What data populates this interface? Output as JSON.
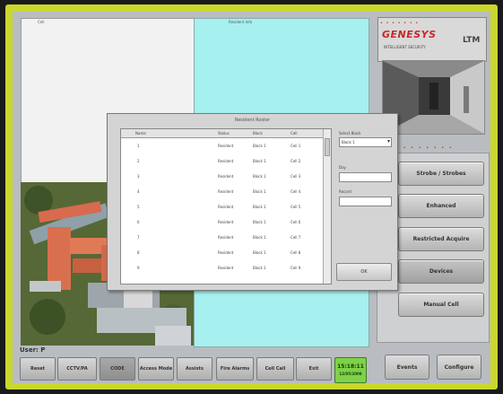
{
  "panels": {
    "left_header": "Cell",
    "right_header": "Resident Info"
  },
  "logo": {
    "name": "GENESYS",
    "tagline": "INTELLIGENT SECURITY",
    "mark": "LTM",
    "dots": "• • • • • • •"
  },
  "side_strip": "• • • • • • • • • •",
  "side_buttons": [
    "Strobe / Strobes",
    "Enhanced",
    "Restricted Acquire",
    "Devices",
    "Manual Cell"
  ],
  "user": {
    "label": "User: P"
  },
  "control_buttons": [
    {
      "label": "Reset"
    },
    {
      "label": "CCTV/PA"
    },
    {
      "label": "CODE"
    },
    {
      "label": "Access Mode"
    },
    {
      "label": "Assists"
    },
    {
      "label": "Fire Alarms"
    },
    {
      "label": "Cell Call"
    },
    {
      "label": "Exit"
    }
  ],
  "clock": {
    "time": "15:18:11",
    "date": "12/05/2008"
  },
  "right_buttons": [
    "Events",
    "Configure"
  ],
  "dialog": {
    "title": "Resident Roster",
    "columns": [
      "Name",
      "Status",
      "Block",
      "Cell"
    ],
    "rows": [
      {
        "name": "1",
        "status": "Resident",
        "block": "Block 1",
        "cell": "Cell 1"
      },
      {
        "name": "2",
        "status": "Resident",
        "block": "Block 1",
        "cell": "Cell 2"
      },
      {
        "name": "3",
        "status": "Resident",
        "block": "Block 1",
        "cell": "Cell 3"
      },
      {
        "name": "4",
        "status": "Resident",
        "block": "Block 1",
        "cell": "Cell 4"
      },
      {
        "name": "5",
        "status": "Resident",
        "block": "Block 1",
        "cell": "Cell 5"
      },
      {
        "name": "6",
        "status": "Resident",
        "block": "Block 1",
        "cell": "Cell 6"
      },
      {
        "name": "7",
        "status": "Resident",
        "block": "Block 1",
        "cell": "Cell 7"
      },
      {
        "name": "8",
        "status": "Resident",
        "block": "Block 1",
        "cell": "Cell 8"
      },
      {
        "name": "9",
        "status": "Resident",
        "block": "Block 1",
        "cell": "Cell 9"
      }
    ],
    "select_label": "Select Block",
    "select_value": "Block 1",
    "field1_label": "Day",
    "field2_label": "Record",
    "ok_label": "OK"
  }
}
